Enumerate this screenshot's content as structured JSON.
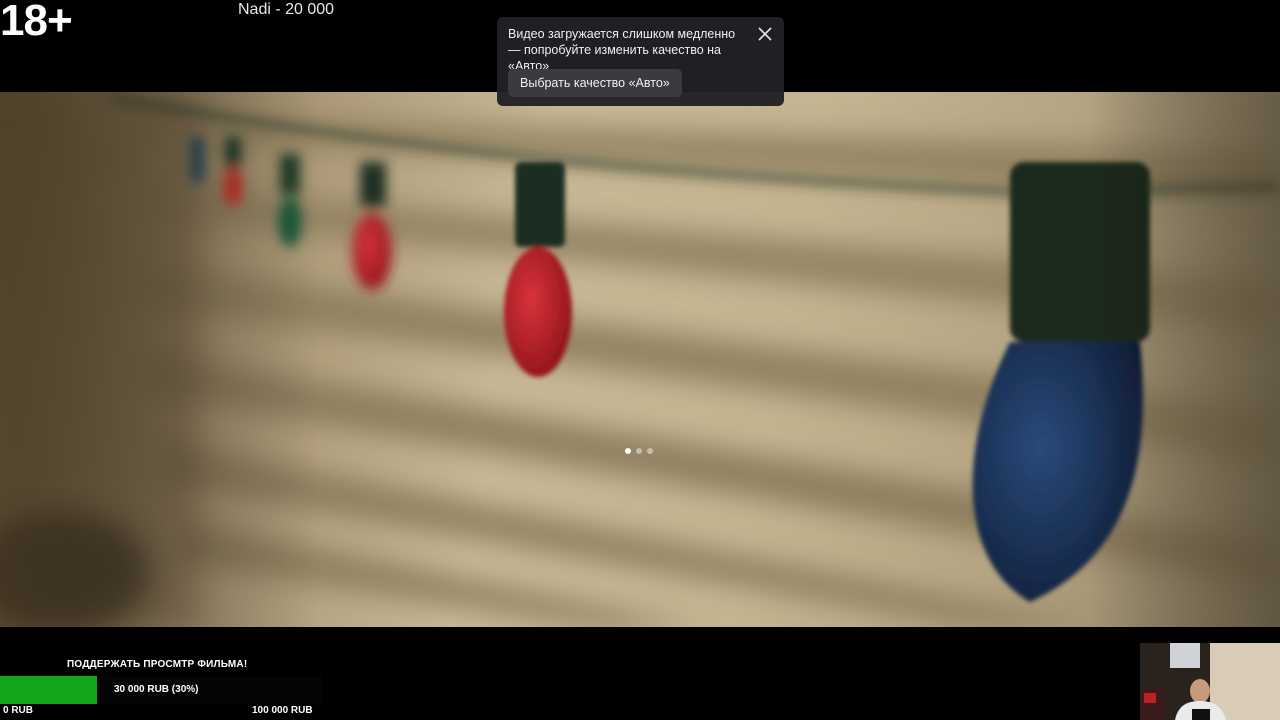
{
  "overlay": {
    "age_rating": "18+",
    "top_donation": "Nadi - 20 000"
  },
  "toast": {
    "message": "Видео загружается слишком медленно — попробуйте изменить качество на «Авто»",
    "button_label": "Выбрать качество «Авто»",
    "close_icon": "close-icon"
  },
  "player": {
    "loading_dots": 3,
    "active_dot": 1
  },
  "donation_goal": {
    "title": "ПОДДЕРЖАТЬ ПРОСМТР ФИЛЬМА!",
    "amount_text": "30 000 RUB (30%)",
    "progress_fraction": 0.3,
    "min_label": "0 RUB",
    "max_label": "100 000 RUB",
    "fill_color": "#13a51c"
  }
}
